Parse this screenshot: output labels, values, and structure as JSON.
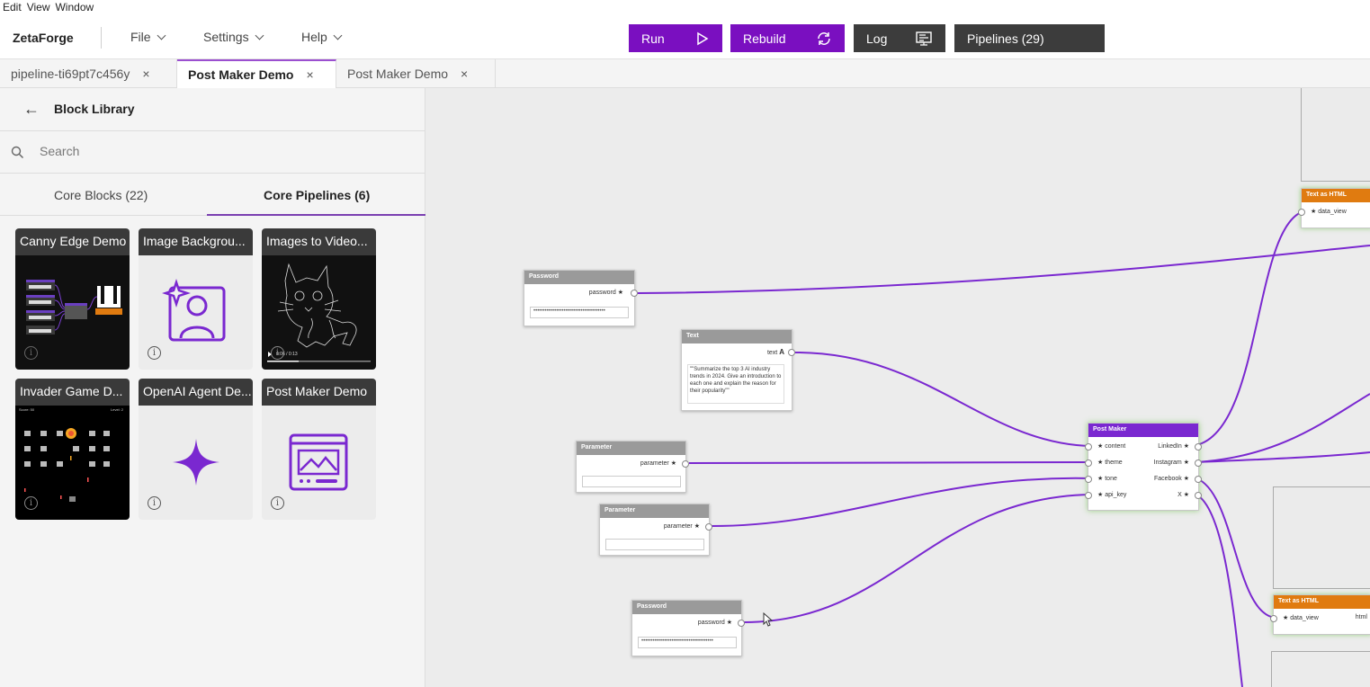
{
  "menubar": {
    "items": [
      "Edit",
      "View",
      "Window"
    ]
  },
  "header": {
    "brand": "ZetaForge",
    "menus": [
      "File",
      "Settings",
      "Help"
    ],
    "run_label": "Run",
    "rebuild_label": "Rebuild",
    "log_label": "Log",
    "pipelines_label": "Pipelines (29)",
    "accent": "#7a0fc0"
  },
  "tabs": [
    {
      "label": "pipeline-ti69pt7c456y",
      "close": "×"
    },
    {
      "label": "Post Maker Demo",
      "close": "×"
    },
    {
      "label": "Post Maker Demo",
      "close": "×"
    }
  ],
  "sidebar": {
    "title": "Block Library",
    "search_placeholder": "Search",
    "section_tabs": [
      "Core Blocks (22)",
      "Core Pipelines (6)"
    ],
    "cards": [
      {
        "title": "Canny Edge Demo",
        "icon": "pipeline-graph-thumbnail",
        "info": "i"
      },
      {
        "title": "Image Backgrou...",
        "icon": "portrait-sparkle-icon",
        "info": "i"
      },
      {
        "title": "Images to Video...",
        "icon": "cat-video-thumbnail",
        "info": "i",
        "video_time": "0:06 / 0:13"
      },
      {
        "title": "Invader Game D...",
        "icon": "invader-game-thumbnail",
        "info": "i",
        "score": "Score: 50",
        "level": "Level: 2"
      },
      {
        "title": "OpenAI Agent De...",
        "icon": "sparkle-icon",
        "info": "i"
      },
      {
        "title": "Post Maker Demo",
        "icon": "image-post-icon",
        "info": "i"
      }
    ]
  },
  "canvas": {
    "wire_color": "#7a28d0",
    "nodes": {
      "password1": {
        "title": "Password",
        "port": "password",
        "value": "••••••••••••••••••••••••••••••••••••••"
      },
      "text": {
        "title": "Text",
        "port": "text",
        "value": "\"\"Summarize the top 3 AI industry trends in 2024. Give an introduction to each one and explain the reason for their popularity\"\""
      },
      "param1": {
        "title": "Parameter",
        "port": "parameter"
      },
      "param2": {
        "title": "Parameter",
        "port": "parameter"
      },
      "password2": {
        "title": "Password",
        "port": "password",
        "value": "••••••••••••••••••••••••••••••••••••••"
      },
      "postmaker": {
        "title": "Post Maker",
        "inputs": [
          "content",
          "theme",
          "tone",
          "api_key"
        ],
        "outputs": [
          "LinkedIn",
          "Instagram",
          "Facebook",
          "X"
        ]
      },
      "html1": {
        "title": "Text as HTML",
        "port": "data_view"
      },
      "html2": {
        "title": "Text as HTML",
        "port": "data_view",
        "out": "html"
      }
    }
  }
}
